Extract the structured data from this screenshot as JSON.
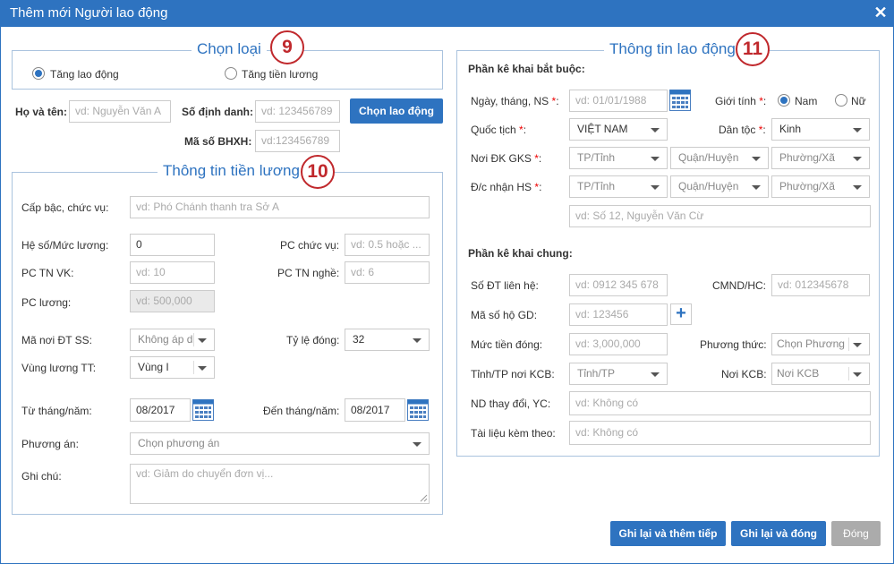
{
  "window": {
    "title": "Thêm mới Người lao động"
  },
  "colors": {
    "accent": "#2e73c0",
    "callout": "#c0282c",
    "required": "#e00"
  },
  "callouts": {
    "c9": "9",
    "c10": "10",
    "c11": "11"
  },
  "choose_type": {
    "legend": "Chọn loại",
    "opt1": "Tăng lao động",
    "opt2": "Tăng tiền lương",
    "selected": "Tăng lao động"
  },
  "person": {
    "name_label": "Họ và tên:",
    "name_ph": "vd: Nguyễn Văn A",
    "id_label": "Số định danh:",
    "id_ph": "vd: 123456789",
    "bhxh_label": "Mã số BHXH:",
    "bhxh_ph": "vd:123456789",
    "choose_btn": "Chọn lao động"
  },
  "salary": {
    "legend": "Thông tin tiền lương",
    "rank_label": "Cấp bậc, chức vụ:",
    "rank_ph": "vd: Phó Chánh thanh tra Sở A",
    "coef_label": "Hệ số/Mức lương:",
    "coef_value": "0",
    "pc_cv_label": "PC chức vụ:",
    "pc_cv_ph": "vd: 0.5 hoặc ...",
    "pc_tnvk_label": "PC TN VK:",
    "pc_tnvk_ph": "vd: 10",
    "pc_tnn_label": "PC TN nghề:",
    "pc_tnn_ph": "vd: 6",
    "pc_luong_label": "PC lương:",
    "pc_luong_ph": "vd: 500,000",
    "ma_noi_label": "Mã nơi ĐT SS:",
    "ma_noi_value": "Không áp d",
    "rate_label": "Tỷ lệ đóng:",
    "rate_value": "32",
    "region_label": "Vùng lương TT:",
    "region_value": "Vùng I",
    "from_label": "Từ tháng/năm:",
    "from_value": "08/2017",
    "to_label": "Đến tháng/năm:",
    "to_value": "08/2017",
    "plan_label": "Phương án:",
    "plan_ph": "Chọn phương án",
    "note_label": "Ghi chú:",
    "note_ph": "vd: Giảm do chuyển đơn vị..."
  },
  "labor": {
    "legend": "Thông tin lao động",
    "mandatory_heading": "Phần kê khai bắt buộc:",
    "dob_label": "Ngày, tháng, NS",
    "dob_ph": "vd: 01/01/1988",
    "gender_label": "Giới tính",
    "male": "Nam",
    "female": "Nữ",
    "gender_selected": "Nam",
    "nation_label": "Quốc tịch",
    "nation_value": "VIỆT NAM",
    "ethnic_label": "Dân tộc",
    "ethnic_value": "Kinh",
    "gks_label": "Nơi ĐK GKS",
    "addr_label": "Đ/c nhận HS",
    "province_ph": "TP/Tỉnh",
    "district_ph": "Quận/Huyện",
    "ward_ph": "Phường/Xã",
    "street_ph": "vd: Số 12, Nguyễn Văn Cừ",
    "common_heading": "Phần kê khai chung:",
    "phone_label": "Số ĐT liên hệ:",
    "phone_ph": "vd: 0912 345 678",
    "cmnd_label": "CMND/HC:",
    "cmnd_ph": "vd: 012345678",
    "household_label": "Mã số hộ GD:",
    "household_ph": "vd: 123456",
    "amount_label": "Mức tiền đóng:",
    "amount_ph": "vd: 3,000,000",
    "method_label": "Phương thức:",
    "method_ph": "Chọn Phương",
    "kcb_prov_label": "Tỉnh/TP nơi KCB:",
    "kcb_prov_ph": "Tỉnh/TP",
    "kcb_label": "Nơi KCB:",
    "kcb_ph": "Nơi KCB",
    "change_label": "ND thay đổi, YC:",
    "change_ph": "vd: Không có",
    "docs_label": "Tài liệu kèm theo:",
    "docs_ph": "vd: Không có"
  },
  "footer": {
    "save_next": "Ghi lại và thêm tiếp",
    "save_close": "Ghi lại và đóng",
    "close": "Đóng"
  }
}
